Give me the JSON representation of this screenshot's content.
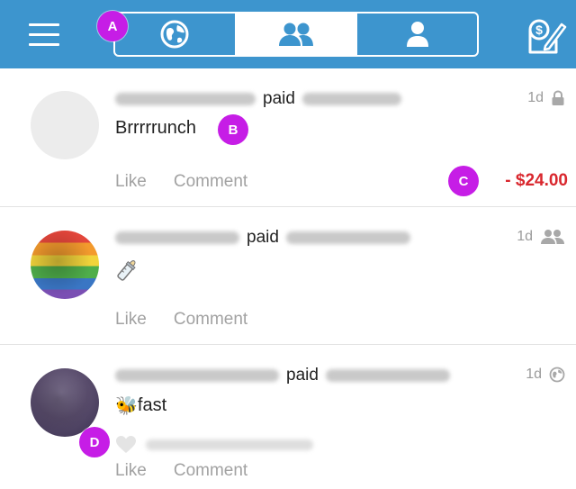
{
  "header": {
    "tabs": [
      {
        "name": "public-feed",
        "icon": "globe-icon",
        "active": false
      },
      {
        "name": "friends-feed",
        "icon": "friends-icon",
        "active": true
      },
      {
        "name": "my-feed",
        "icon": "person-icon",
        "active": false
      }
    ]
  },
  "feed": [
    {
      "verb": "paid",
      "note": "Brrrrrunch",
      "time": "1d",
      "privacy_icon": "lock-icon",
      "like_label": "Like",
      "comment_label": "Comment",
      "amount": "- $24.00"
    },
    {
      "verb": "paid",
      "note_icon": "baby-bottle-icon",
      "time": "1d",
      "privacy_icon": "friends-icon",
      "like_label": "Like",
      "comment_label": "Comment"
    },
    {
      "verb": "paid",
      "note_emoji": "🐝",
      "note": "fast",
      "time": "1d",
      "privacy_icon": "globe-icon",
      "like_label": "Like",
      "comment_label": "Comment"
    }
  ],
  "markers": {
    "a": "A",
    "b": "B",
    "c": "C",
    "d": "D"
  },
  "colors": {
    "brand_blue": "#3d95ce",
    "charge_red": "#d9272e",
    "marker_purple": "#c61de6"
  }
}
